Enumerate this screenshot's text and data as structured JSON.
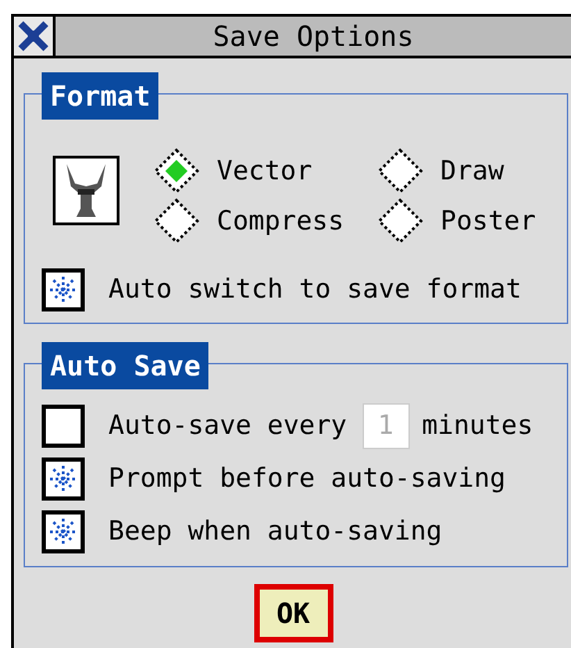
{
  "window": {
    "title": "Save Options"
  },
  "format": {
    "title": "Format",
    "options": [
      {
        "label": "Vector",
        "selected": true
      },
      {
        "label": "Draw",
        "selected": false
      },
      {
        "label": "Compress",
        "selected": false
      },
      {
        "label": "Poster",
        "selected": false
      }
    ],
    "auto_switch": {
      "label": "Auto switch to save format",
      "checked": true
    }
  },
  "auto_save": {
    "title": "Auto Save",
    "rows": [
      {
        "kind": "interval",
        "label": "Auto-save every",
        "checked": false,
        "field": {
          "value": "1",
          "disabled": true
        },
        "unit": "minutes"
      },
      {
        "kind": "checkbox",
        "label": "Prompt before auto-saving",
        "checked": true
      },
      {
        "kind": "checkbox",
        "label": "Beep when auto-saving",
        "checked": true
      }
    ]
  },
  "buttons": [
    {
      "label": "OK",
      "default": true
    }
  ]
}
